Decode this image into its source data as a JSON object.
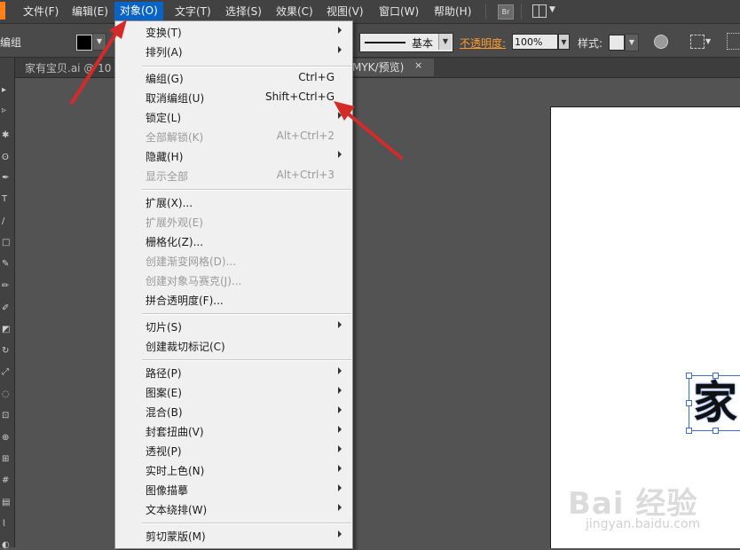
{
  "menubar": {
    "items": [
      "文件(F)",
      "编辑(E)",
      "对象(O)",
      "文字(T)",
      "选择(S)",
      "效果(C)",
      "视图(V)",
      "窗口(W)",
      "帮助(H)"
    ],
    "br_label": "Br"
  },
  "control": {
    "left_label": "编组",
    "stroke_style": "基本",
    "opacity_label": "不透明度:",
    "opacity_value": "100%",
    "style_label": "样式:"
  },
  "tabs": {
    "doc1": "家有宝贝.ai @ 10",
    "doc2": "MYK/预览)",
    "close": "×"
  },
  "canvas": {
    "glyph": "家"
  },
  "watermark": {
    "brand": "Bai 经验",
    "url": "jingyan.baidu.com"
  },
  "object_menu": {
    "items": [
      {
        "label": "变换(T)",
        "shortcut": "",
        "submenu": true,
        "enabled": true
      },
      {
        "label": "排列(A)",
        "shortcut": "",
        "submenu": true,
        "enabled": true
      },
      {
        "label": "编组(G)",
        "shortcut": "Ctrl+G",
        "submenu": false,
        "enabled": true
      },
      {
        "label": "取消编组(U)",
        "shortcut": "Shift+Ctrl+G",
        "submenu": false,
        "enabled": true
      },
      {
        "label": "锁定(L)",
        "shortcut": "",
        "submenu": true,
        "enabled": true
      },
      {
        "label": "全部解锁(K)",
        "shortcut": "Alt+Ctrl+2",
        "submenu": false,
        "enabled": false
      },
      {
        "label": "隐藏(H)",
        "shortcut": "",
        "submenu": true,
        "enabled": true
      },
      {
        "label": "显示全部",
        "shortcut": "Alt+Ctrl+3",
        "submenu": false,
        "enabled": false
      },
      {
        "label": "扩展(X)...",
        "shortcut": "",
        "submenu": false,
        "enabled": true
      },
      {
        "label": "扩展外观(E)",
        "shortcut": "",
        "submenu": false,
        "enabled": false
      },
      {
        "label": "栅格化(Z)...",
        "shortcut": "",
        "submenu": false,
        "enabled": true
      },
      {
        "label": "创建渐变网格(D)...",
        "shortcut": "",
        "submenu": false,
        "enabled": false
      },
      {
        "label": "创建对象马赛克(J)...",
        "shortcut": "",
        "submenu": false,
        "enabled": false
      },
      {
        "label": "拼合透明度(F)...",
        "shortcut": "",
        "submenu": false,
        "enabled": true
      },
      {
        "label": "切片(S)",
        "shortcut": "",
        "submenu": true,
        "enabled": true
      },
      {
        "label": "创建裁切标记(C)",
        "shortcut": "",
        "submenu": false,
        "enabled": true
      },
      {
        "label": "路径(P)",
        "shortcut": "",
        "submenu": true,
        "enabled": true
      },
      {
        "label": "图案(E)",
        "shortcut": "",
        "submenu": true,
        "enabled": true
      },
      {
        "label": "混合(B)",
        "shortcut": "",
        "submenu": true,
        "enabled": true
      },
      {
        "label": "封套扭曲(V)",
        "shortcut": "",
        "submenu": true,
        "enabled": true
      },
      {
        "label": "透视(P)",
        "shortcut": "",
        "submenu": true,
        "enabled": true
      },
      {
        "label": "实时上色(N)",
        "shortcut": "",
        "submenu": true,
        "enabled": true
      },
      {
        "label": "图像描摹",
        "shortcut": "",
        "submenu": true,
        "enabled": true
      },
      {
        "label": "文本绕排(W)",
        "shortcut": "",
        "submenu": true,
        "enabled": true
      },
      {
        "label": "剪切蒙版(M)",
        "shortcut": "",
        "submenu": true,
        "enabled": true
      }
    ]
  },
  "colors": {
    "menu_highlight": "#0a64c8",
    "annotation_arrow": "#d42a2a",
    "opacity_label": "#ff9a2e"
  }
}
